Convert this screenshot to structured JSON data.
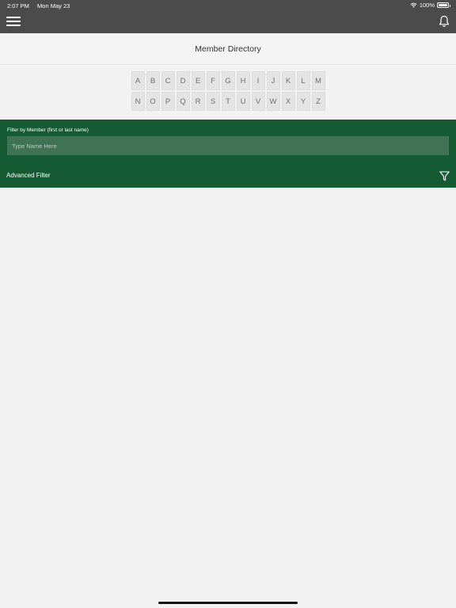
{
  "status_bar": {
    "time": "2:07 PM",
    "date": "Mon May 23",
    "battery": "100%"
  },
  "header": {
    "menu_icon": "hamburger-menu-icon",
    "notification_icon": "bell-icon",
    "background_color": "#4b4b4b"
  },
  "page": {
    "title": "Member Directory"
  },
  "alphabet": {
    "row1": [
      "A",
      "B",
      "C",
      "D",
      "E",
      "F",
      "G",
      "H",
      "I",
      "J",
      "K",
      "L",
      "M"
    ],
    "row2": [
      "N",
      "O",
      "P",
      "Q",
      "R",
      "S",
      "T",
      "U",
      "V",
      "W",
      "X",
      "Y",
      "Z"
    ]
  },
  "filter": {
    "label": "Filter by Member (first or last name)",
    "placeholder": "Type Name Here",
    "value": "",
    "advanced_label": "Advanced Filter",
    "advanced_icon": "funnel-icon",
    "panel_color": "#145a32"
  }
}
